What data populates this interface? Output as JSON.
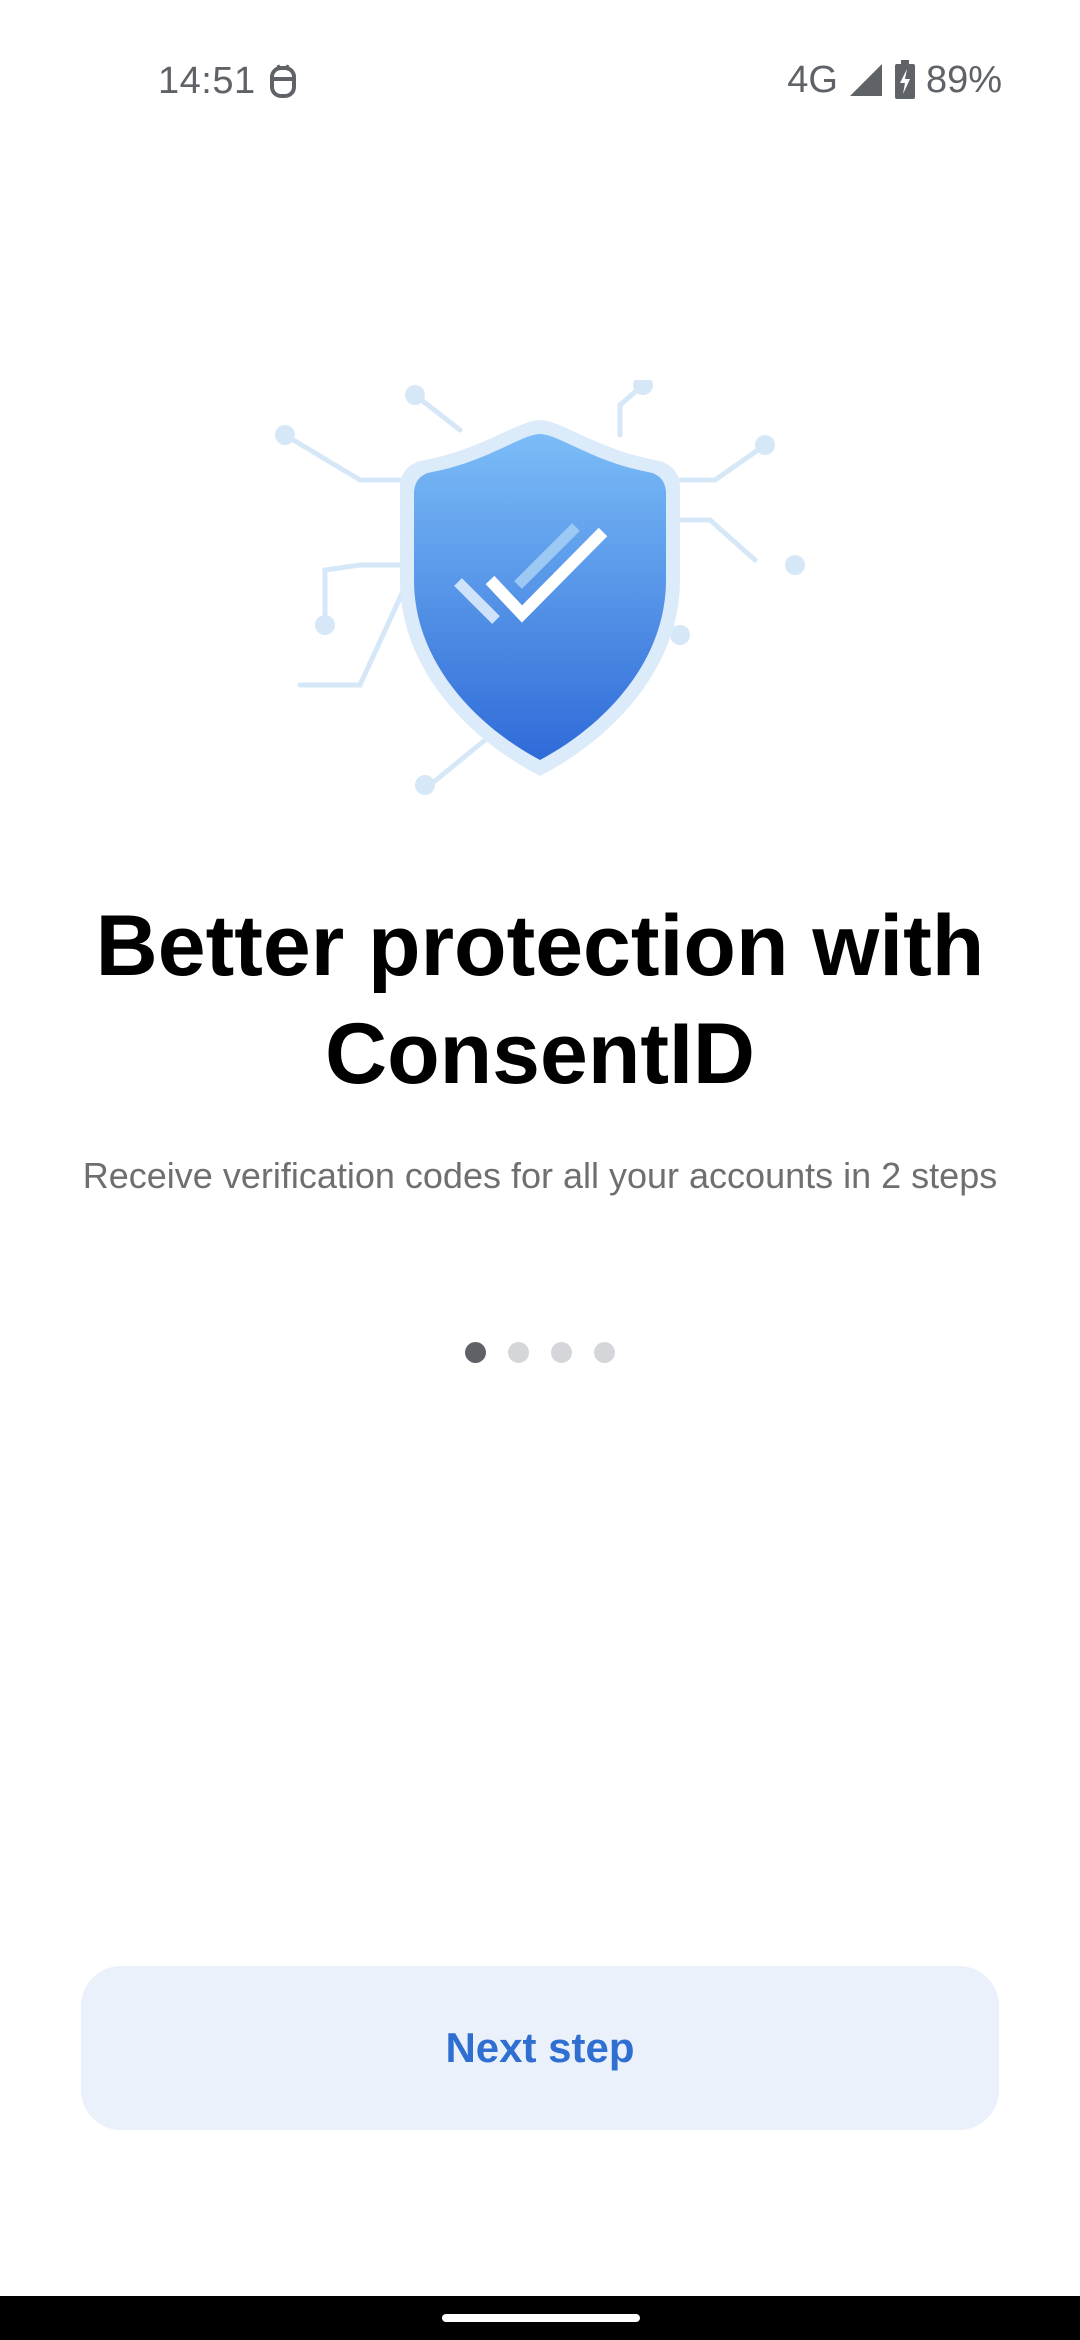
{
  "status_bar": {
    "time": "14:51",
    "network": "4G",
    "battery": "89%",
    "icons": [
      "notification-icon",
      "signal-icon",
      "battery-charging-icon"
    ]
  },
  "illustration": {
    "icon": "shield-check-icon",
    "colors": {
      "shield_top": "#7bbcf7",
      "shield_bottom": "#2f6bd8",
      "network_lines": "#d6e8f8"
    }
  },
  "onboarding": {
    "title": "Better protection with ConsentID",
    "subtitle": "Receive verification codes for all your accounts in 2 steps",
    "page_indicator": {
      "total": 4,
      "current": 1
    },
    "next_label": "Next step"
  },
  "colors": {
    "accent": "#2f6fd1",
    "button_background": "#ebf1fa",
    "dot_active": "#5f6166",
    "dot_inactive": "#d4d6da"
  }
}
